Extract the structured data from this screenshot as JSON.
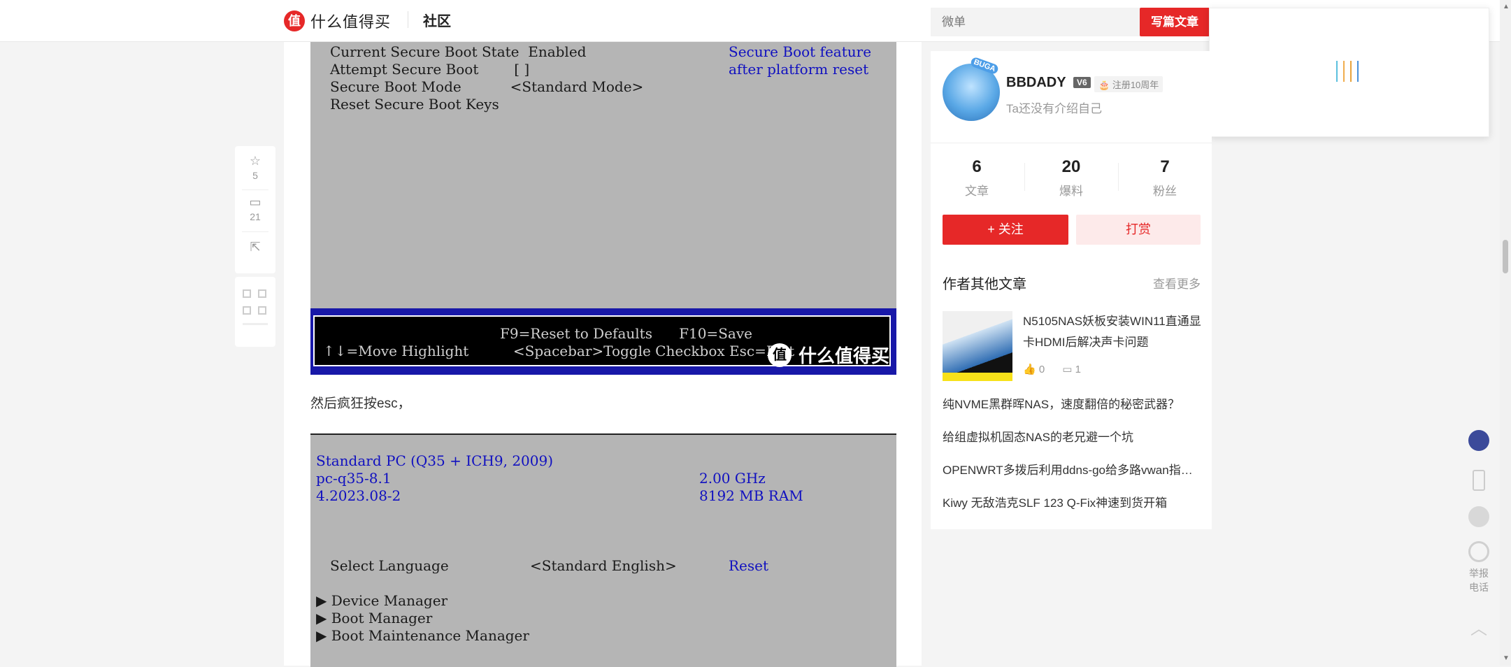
{
  "header": {
    "logo_mark": "值",
    "logo_text": "什么值得买",
    "community": "社区",
    "search_placeholder": "微单",
    "write_button": "写篇文章"
  },
  "toolbar": {
    "favorite_count": "5",
    "comment_count": "21"
  },
  "bios1": {
    "lines": [
      "Current Secure Boot State  Enabled",
      "Attempt Secure Boot        [ ]",
      "Secure Boot Mode           <Standard Mode>",
      "Reset Secure Boot Keys"
    ],
    "help_lines": [
      "Secure Boot feature",
      "after platform reset"
    ],
    "footer_line1": "F9=Reset to Defaults      F10=Save",
    "footer_line2": "↑↓=Move Highlight          <Spacebar>Toggle Checkbox Esc=Exit",
    "watermark": "什么值得买"
  },
  "caption": "然后疯狂按esc，",
  "bios2": {
    "l1": "Standard PC (Q35 + ICH9, 2009)",
    "l2": "pc-q35-8.1",
    "l3": "4.2023.08-2",
    "r2": "2.00 GHz",
    "r3": "8192 MB RAM",
    "lang_label": "Select Language",
    "lang_value": "<Standard English>",
    "lang_reset": "Reset",
    "menu": [
      "▶ Device Manager",
      "▶ Boot Manager",
      "▶ Boot Maintenance Manager"
    ]
  },
  "profile": {
    "avatar_badge": "BUGA",
    "username": "BBDADY",
    "level": "V6",
    "register_badge": "注册10周年",
    "intro": "Ta还没有介绍自己",
    "stats": [
      {
        "num": "6",
        "label": "文章"
      },
      {
        "num": "20",
        "label": "爆料"
      },
      {
        "num": "7",
        "label": "粉丝"
      }
    ],
    "follow": "+ 关注",
    "tip": "打赏",
    "more_title": "作者其他文章",
    "more_link": "查看更多",
    "featured": {
      "title": "N5105NAS妖板安装WIN11直通显卡HDMI后解决声卡问题",
      "likes": "0",
      "comments": "1"
    },
    "articles": [
      "纯NVME黑群晖NAS，速度翻倍的秘密武器？",
      "给组虚拟机固态NAS的老兄避一个坑",
      "OPENWRT多拨后利用ddns-go给多路vwan指定域名",
      "Kiwy 无敌浩克SLF 123 Q-Fix神速到货开箱"
    ]
  },
  "float": {
    "report": "举报电话"
  },
  "colors": {
    "brand_red": "#e62828",
    "bios_blue": "#1010c0",
    "bios_bg": "#b5b5b5"
  }
}
